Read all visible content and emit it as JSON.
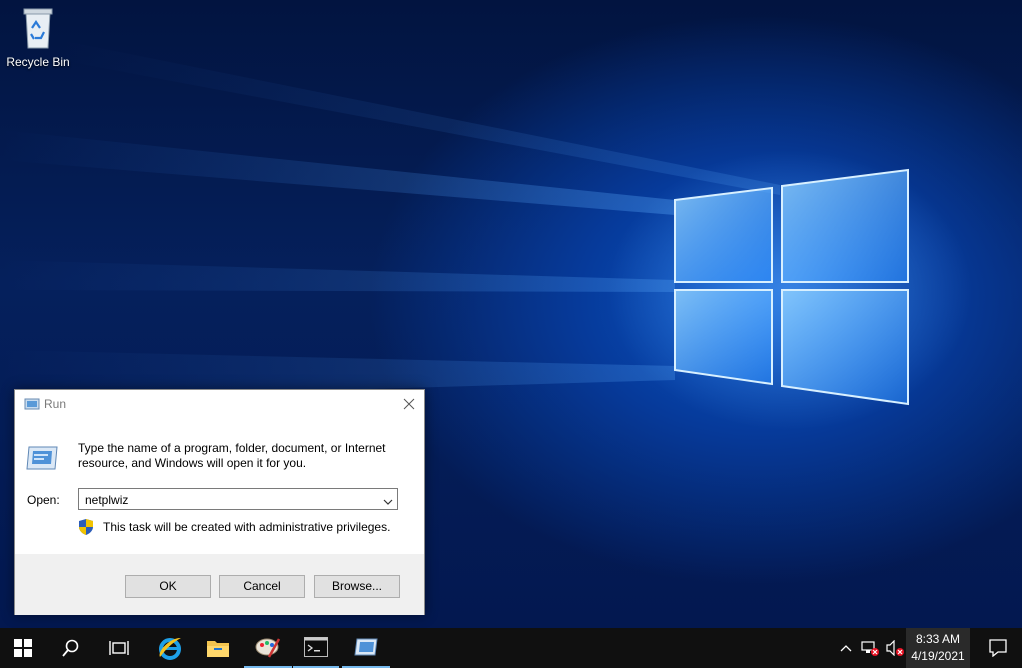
{
  "desktop": {
    "icons": [
      {
        "label": "Recycle Bin",
        "icon": "recycle-bin-icon"
      }
    ]
  },
  "run_dialog": {
    "title": "Run",
    "description": "Type the name of a program, folder, document, or Internet resource, and Windows will open it for you.",
    "open_label": "Open:",
    "open_value": "netplwiz",
    "admin_note": "This task will be created with administrative privileges.",
    "buttons": {
      "ok": "OK",
      "cancel": "Cancel",
      "browse": "Browse..."
    }
  },
  "taskbar": {
    "pinned": [
      "start-icon",
      "search-icon",
      "task-view-icon",
      "internet-explorer-icon",
      "file-explorer-icon",
      "paint-icon",
      "command-prompt-icon",
      "run-icon"
    ],
    "clock": {
      "time": "8:33 AM",
      "date": "4/19/2021"
    },
    "accent_color": "#76b9ed"
  }
}
